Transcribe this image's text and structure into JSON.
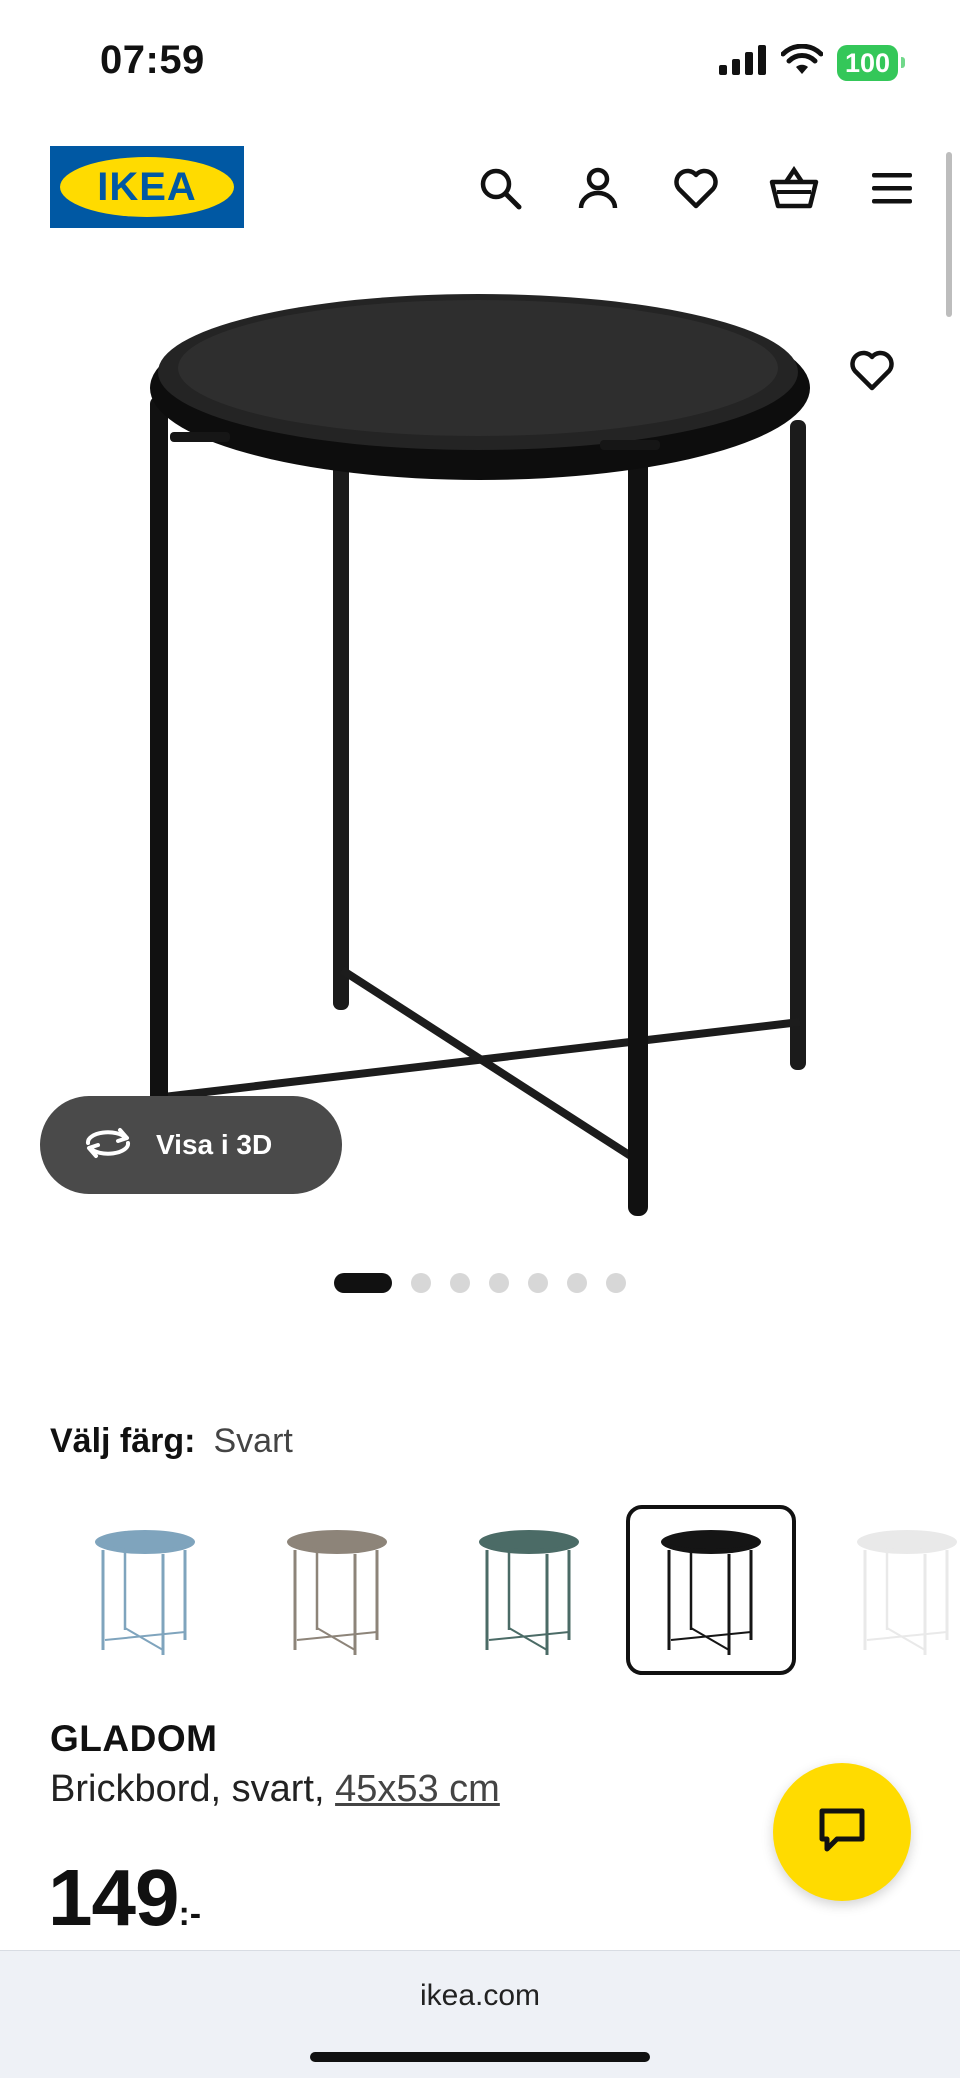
{
  "status_bar": {
    "time": "07:59",
    "battery": "100"
  },
  "header": {
    "logo_text": "IKEA"
  },
  "gallery": {
    "view_3d_label": "Visa i 3D",
    "image_count": 7,
    "active_index": 0
  },
  "color_picker": {
    "label": "Välj färg:",
    "selected_value": "Svart",
    "swatches": [
      {
        "name": "light-blue",
        "color": "#7fa4bd"
      },
      {
        "name": "beige",
        "color": "#8d8479"
      },
      {
        "name": "dark-green",
        "color": "#4b6b66"
      },
      {
        "name": "black",
        "color": "#151515",
        "selected": true
      },
      {
        "name": "white",
        "color": "#e9e9e9"
      }
    ]
  },
  "product": {
    "name": "GLADOM",
    "description_prefix": "Brickbord, svart, ",
    "size": "45x53 cm",
    "price_int": "149",
    "price_suffix": ":-"
  },
  "browser": {
    "url": "ikea.com"
  },
  "colors": {
    "brand_blue": "#0058a3",
    "brand_yellow": "#ffdb00",
    "battery_green": "#34c759"
  }
}
